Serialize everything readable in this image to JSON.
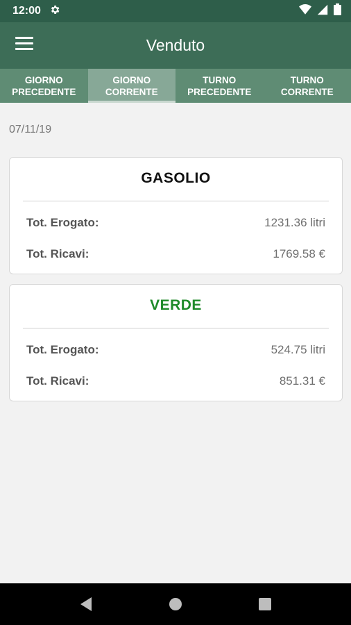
{
  "status_bar": {
    "time": "12:00",
    "icons": [
      "gear-icon",
      "wifi-icon",
      "signal-icon",
      "battery-icon"
    ]
  },
  "app_bar": {
    "title": "Venduto",
    "menu_icon": "menu-icon"
  },
  "tabs": [
    {
      "label": "GIORNO\nPRECEDENTE",
      "active": false
    },
    {
      "label": "GIORNO\nCORRENTE",
      "active": true
    },
    {
      "label": "TURNO\nPRECEDENTE",
      "active": false
    },
    {
      "label": "TURNO\nCORRENTE",
      "active": false
    }
  ],
  "date": "07/11/19",
  "cards": [
    {
      "title": "GASOLIO",
      "title_color": "#111111",
      "rows": [
        {
          "label": "Tot. Erogato:",
          "value": "1231.36 litri"
        },
        {
          "label": "Tot. Ricavi:",
          "value": "1769.58 €"
        }
      ]
    },
    {
      "title": "VERDE",
      "title_color": "#1f8a2a",
      "rows": [
        {
          "label": "Tot. Erogato:",
          "value": "524.75 litri"
        },
        {
          "label": "Tot. Ricavi:",
          "value": "851.31 €"
        }
      ]
    }
  ],
  "nav_bar": {
    "icons": [
      "back-icon",
      "home-icon",
      "recents-icon"
    ]
  },
  "colors": {
    "status_bar": "#2e5e4a",
    "app_bar": "#3d6d57",
    "tab_bar": "#5f8c74",
    "tab_active": "#87a897"
  }
}
